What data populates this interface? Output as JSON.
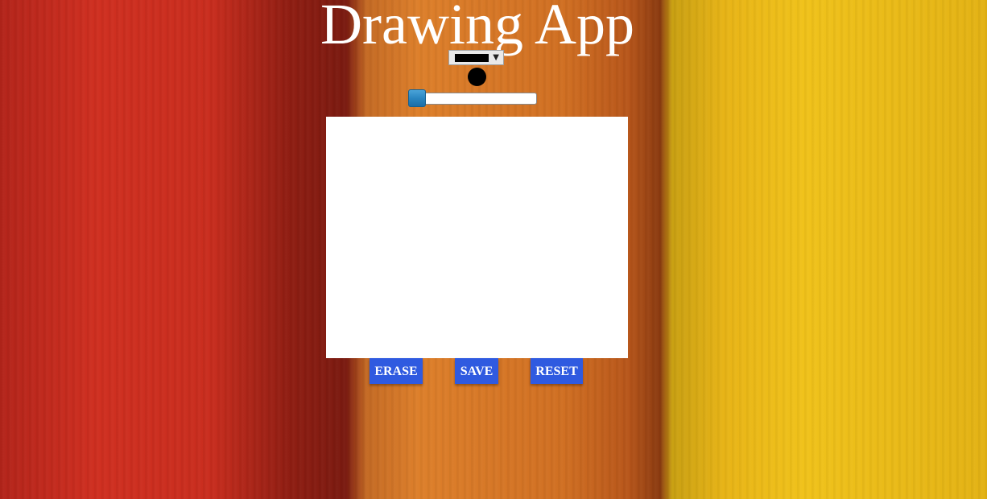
{
  "app": {
    "title": "Drawing App"
  },
  "toolbar": {
    "color_select": {
      "selected_color": "#000000"
    },
    "brush_preview_color": "#000000",
    "size_slider": {
      "value_fraction": 0.0
    }
  },
  "canvas": {
    "background": "#ffffff"
  },
  "buttons": {
    "erase_label": "ERASE",
    "save_label": "SAVE",
    "reset_label": "RESET",
    "color": "#2f5ae0"
  }
}
